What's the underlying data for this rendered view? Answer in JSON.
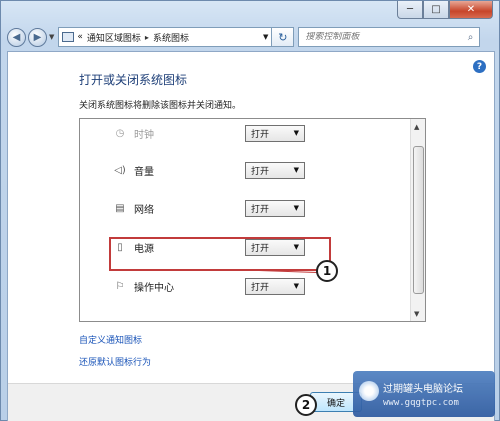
{
  "window": {
    "controls": {
      "minimize": "─",
      "maximize": "□",
      "close": "✕"
    }
  },
  "navigation": {
    "back_icon": "back-arrow",
    "forward_icon": "forward-arrow",
    "address": {
      "root": "«",
      "segments": [
        "通知区域图标",
        "系统图标"
      ],
      "separator": "▸"
    },
    "refresh_icon": "refresh",
    "search_placeholder": "搜索控制面板"
  },
  "content": {
    "help_icon": "?",
    "title": "打开或关闭系统图标",
    "description": "关闭系统图标将删除该图标并关闭通知。",
    "system_icons": [
      {
        "label": "时钟",
        "icon": "clock-icon",
        "value": "打开",
        "faded": true
      },
      {
        "label": "音量",
        "icon": "speaker-icon",
        "value": "打开"
      },
      {
        "label": "网络",
        "icon": "network-icon",
        "value": "打开"
      },
      {
        "label": "电源",
        "icon": "power-icon",
        "value": "打开",
        "highlighted": true
      },
      {
        "label": "操作中心",
        "icon": "flag-icon",
        "value": "打开"
      }
    ],
    "links": [
      "自定义通知图标",
      "还原默认图标行为"
    ],
    "callouts": [
      "1",
      "2"
    ]
  },
  "footer": {
    "ok_label": "确定"
  },
  "watermark": {
    "name": "过期罐头电脑论坛",
    "url": "www.gqgtpc.com"
  },
  "colors": {
    "highlight": "#c23b3b",
    "link": "#1a54b8",
    "title": "#1e3f78"
  }
}
